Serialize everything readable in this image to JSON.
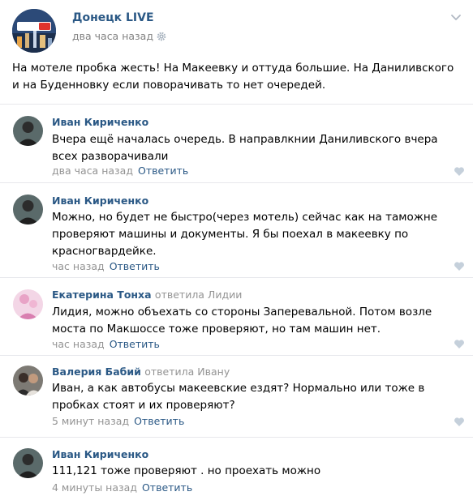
{
  "post": {
    "group_name": "Донецк LIVE",
    "time": "два часа назад",
    "text": "На мотеле пробка жесть! На Макеевку и оттуда большие. На Даниливского и на Буденновку если поворачивать то нет очередей.",
    "avatar_logo_text": "Донецк Live"
  },
  "comments": [
    {
      "author": "Иван Кириченко",
      "reply_to": "",
      "text": "Вчера ещё началась очередь. В направлкнии Даниливского вчера всех разворачивали",
      "time": "два часа назад",
      "reply_label": "Ответить"
    },
    {
      "author": "Иван Кириченко",
      "reply_to": "",
      "text": "Можно, но будет не быстро(через мотель) сейчас как на таможне проверяют машины и документы. Я бы поехал в макеевку по красногвардейке.",
      "time": "час назад",
      "reply_label": "Ответить"
    },
    {
      "author": "Екатерина Тонха",
      "reply_to": "ответила Лидии",
      "text": "Лидия, можно объехать со стороны Заперевальной. Потом возле моста по Макшоссе тоже проверяют, но там машин нет.",
      "time": "час назад",
      "reply_label": "Ответить"
    },
    {
      "author": "Валерия Бабий",
      "reply_to": "ответила Ивану",
      "text": "Иван, а как автобусы макеевские ездят? Нормально или тоже в пробках стоят и их проверяют?",
      "time": "5 минут назад",
      "reply_label": "Ответить"
    },
    {
      "author": "Иван Кириченко",
      "reply_to": "",
      "text": "111,121 тоже проверяют . но проехать можно",
      "time": "4 минуты назад",
      "reply_label": "Ответить"
    }
  ],
  "colors": {
    "link": "#2a5885",
    "muted": "#939393",
    "divider": "#e7e8ec"
  },
  "icons": {
    "post_menu": "chevron-down-icon",
    "settings": "gear-icon",
    "like": "heart-icon"
  }
}
